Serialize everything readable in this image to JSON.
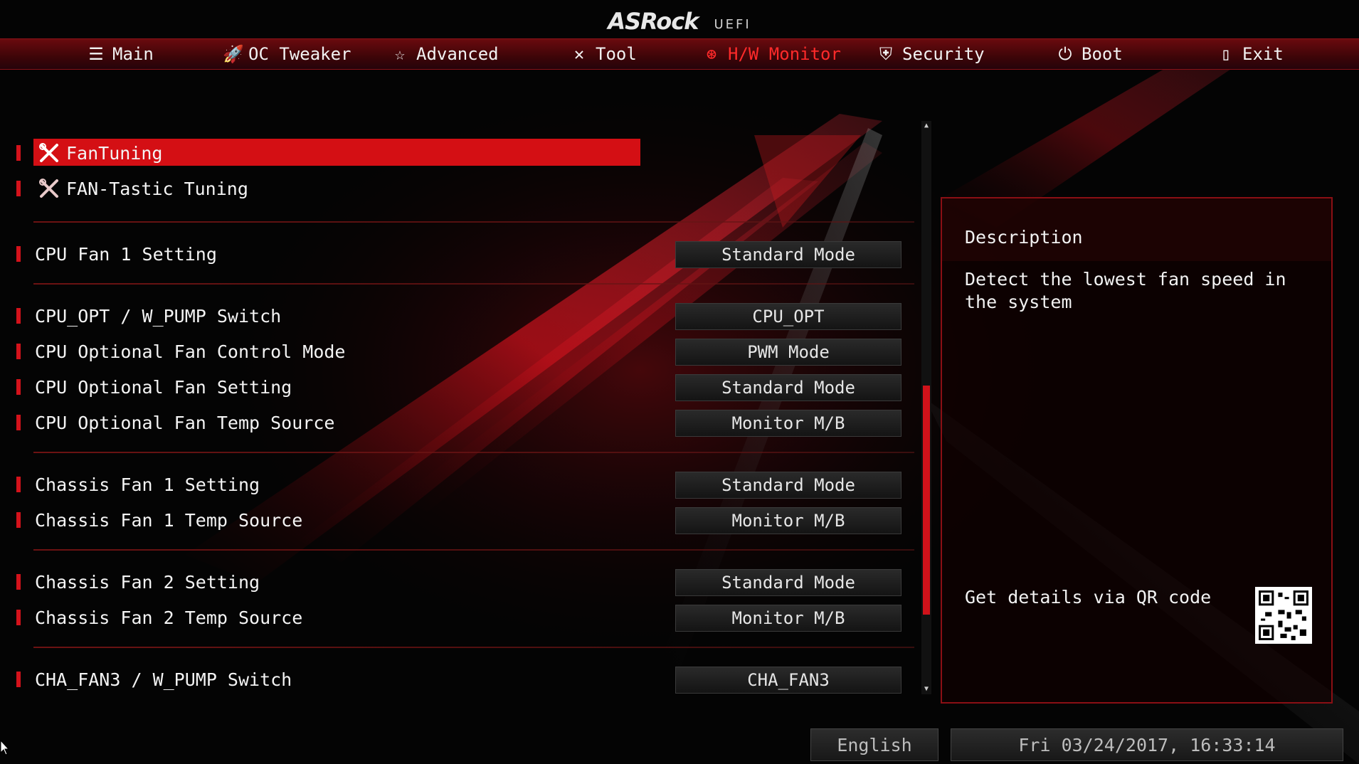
{
  "brand": {
    "logo": "ASRock",
    "suffix": "UEFI"
  },
  "menu": [
    {
      "label": "Main",
      "icon": "list-icon",
      "active": false
    },
    {
      "label": "OC Tweaker",
      "icon": "rocket-icon",
      "active": false
    },
    {
      "label": "Advanced",
      "icon": "star-icon",
      "active": false
    },
    {
      "label": "Tool",
      "icon": "tools-icon",
      "active": false
    },
    {
      "label": "H/W Monitor",
      "icon": "monitor-gauge-icon",
      "active": true
    },
    {
      "label": "Security",
      "icon": "shield-icon",
      "active": false
    },
    {
      "label": "Boot",
      "icon": "power-icon",
      "active": false
    },
    {
      "label": "Exit",
      "icon": "exit-door-icon",
      "active": false
    }
  ],
  "items": {
    "fan_tuning": "FanTuning",
    "fan_tastic": "FAN-Tastic Tuning",
    "cpu_fan1_setting": {
      "label": "CPU Fan 1 Setting",
      "value": "Standard Mode"
    },
    "cpu_opt_switch": {
      "label": "CPU_OPT / W_PUMP Switch",
      "value": "CPU_OPT"
    },
    "cpu_opt_control_mode": {
      "label": "CPU Optional Fan Control Mode",
      "value": "PWM Mode"
    },
    "cpu_opt_setting": {
      "label": "CPU Optional Fan Setting",
      "value": "Standard Mode"
    },
    "cpu_opt_temp_source": {
      "label": "CPU Optional Fan Temp Source",
      "value": "Monitor M/B"
    },
    "cha_fan1_setting": {
      "label": "Chassis Fan 1 Setting",
      "value": "Standard Mode"
    },
    "cha_fan1_temp_source": {
      "label": "Chassis Fan 1 Temp Source",
      "value": "Monitor M/B"
    },
    "cha_fan2_setting": {
      "label": "Chassis Fan 2 Setting",
      "value": "Standard Mode"
    },
    "cha_fan2_temp_source": {
      "label": "Chassis Fan 2 Temp Source",
      "value": "Monitor M/B"
    },
    "cha_fan3_switch": {
      "label": "CHA_FAN3 / W_PUMP Switch",
      "value": "CHA_FAN3"
    }
  },
  "description": {
    "title": "Description",
    "text": "Detect the lowest fan speed in the system",
    "qr_label": "Get details via QR code"
  },
  "status": {
    "language": "English",
    "datetime": "Fri 03/24/2017, 16:33:14"
  },
  "colors": {
    "accent": "#d40f14",
    "active_menu": "#ff2a2a",
    "menubar": "#4a070b"
  }
}
